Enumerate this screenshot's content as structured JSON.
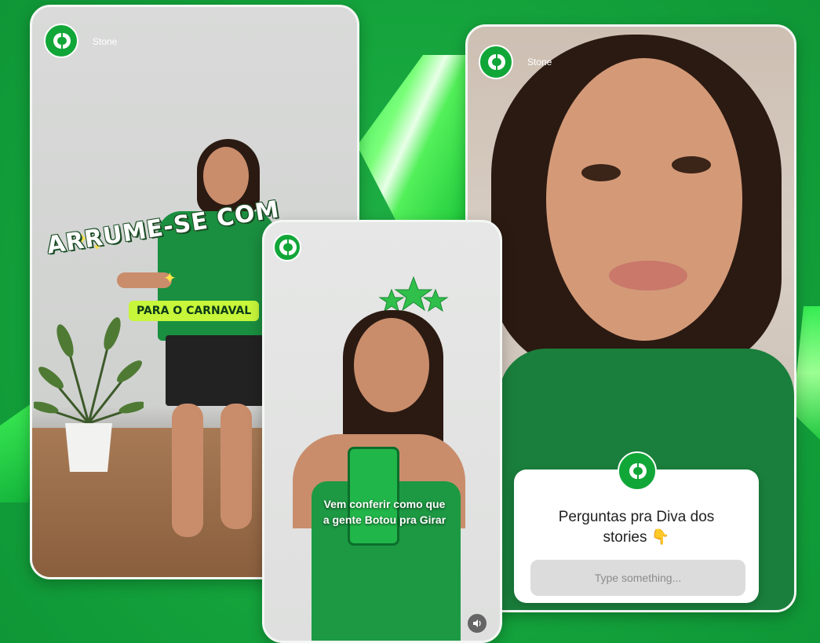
{
  "brand": {
    "name": "Stone",
    "color": "#11a638",
    "logo_icon": "stone-logo-icon"
  },
  "story_left": {
    "sticker_title": "ARRUME-SE COM",
    "sticker_subtitle": "PARA O CARNAVAL"
  },
  "story_middle": {
    "caption_line1": "Vem conferir como que",
    "caption_line2": "a gente Botou pra Girar",
    "sound_icon": "volume-icon"
  },
  "story_right": {
    "question_title_line1": "Perguntas pra Diva dos",
    "question_title_line2": "stories",
    "question_emoji": "👇",
    "input_placeholder": "Type something..."
  },
  "colors": {
    "background": "#14a33c",
    "sticker_subtitle_bg": "#c7f63a"
  }
}
